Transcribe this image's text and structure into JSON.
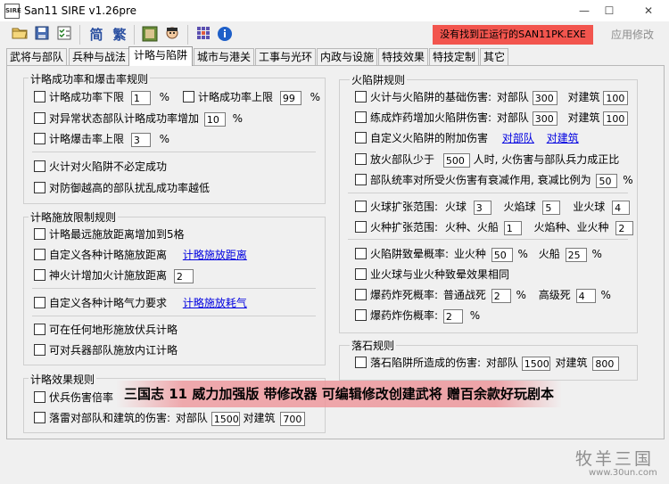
{
  "window": {
    "title": "San11 SIRE v1.26pre",
    "logo_text": "SIRE",
    "minimize": "—",
    "maximize": "☐",
    "close": "✕"
  },
  "toolbar": {
    "simplified": "简",
    "traditional": "繁",
    "status_alert": "没有找到正运行的SAN11PK.EXE",
    "apply_label": "应用修改"
  },
  "tabs": [
    "武将与部队",
    "兵种与战法",
    "计略与陷阱",
    "城市与港关",
    "工事与光环",
    "内政与设施",
    "特技效果",
    "特技定制",
    "其它"
  ],
  "active_tab": "计略与陷阱",
  "strategy_rate": {
    "title": "计略成功率和爆击率规则",
    "min_rate_label": "计略成功率下限",
    "min_rate_value": "1",
    "min_rate_unit": "%",
    "max_rate_label": "计略成功率上限",
    "max_rate_value": "99",
    "max_rate_unit": "%",
    "abnormal_label": "对异常状态部队计略成功率增加",
    "abnormal_value": "10",
    "abnormal_unit": "%",
    "crit_label": "计略爆击率上限",
    "crit_value": "3",
    "crit_unit": "%",
    "fire_label": "火计对火陷阱不必定成功",
    "defense_label": "对防御越高的部队扰乱成功率越低"
  },
  "cast_limit": {
    "title": "计略施放限制规则",
    "max_distance_label": "计略最远施放距离增加到5格",
    "custom_distance_label": "自定义各种计略施放距离",
    "custom_distance_link": "计略施放距离",
    "shenhuo_label": "神火计增加火计施放距离",
    "shenhuo_value": "2",
    "custom_energy_label": "自定义各种计略气力要求",
    "custom_energy_link": "计略施放耗气",
    "ambush_label": "可在任何地形施放伏兵计略",
    "weapon_label": "可对兵器部队施放内讧计略"
  },
  "strategy_effect": {
    "title": "计略效果规则",
    "ambush_dmg_label": "伏兵伤害倍率",
    "thunder_label": "落雷对部队和建筑的伤害:",
    "vs_unit_label": "对部队",
    "vs_unit_value": "1500",
    "vs_building_label": "对建筑",
    "vs_building_value": "700"
  },
  "fire_trap": {
    "title": "火陷阱规则",
    "base_label": "火计与火陷阱的基础伤害:",
    "base_unit_label": "对部队",
    "base_unit_value": "300",
    "base_building_label": "对建筑",
    "base_building_value": "100",
    "explosive_label": "练成炸药增加火陷阱伤害:",
    "explosive_unit_label": "对部队",
    "explosive_unit_value": "300",
    "explosive_building_label": "对建筑",
    "explosive_building_value": "100",
    "custom_label": "自定义火陷阱的附加伤害",
    "custom_unit_link": "对部队",
    "custom_building_link": "对建筑",
    "few_troops_prefix": "放火部队少于",
    "few_troops_value": "500",
    "few_troops_suffix": "人时, 火伤害与部队兵力成正比",
    "decay_label": "部队统率对所受火伤害有衰减作用, 衰减比例为",
    "decay_value": "50",
    "decay_unit": "%",
    "fireball_label": "火球扩张范围:",
    "fireball_name": "火球",
    "fireball_value": "3",
    "flameball_name": "火焰球",
    "flameball_value": "5",
    "hellball_name": "业火球",
    "hellball_value": "4",
    "firetype_label": "火种扩张范围:",
    "firetype_pair1": "火种、火船",
    "firetype_value1": "1",
    "firetype_pair2": "火焰种、业火种",
    "firetype_value2": "2",
    "ignite_label": "火陷阱致晕概率:",
    "ignite_name1": "业火种",
    "ignite_value1": "50",
    "ignite_unit1": "%",
    "ignite_name2": "火船",
    "ignite_value2": "25",
    "ignite_unit2": "%",
    "same_effect_label": "业火球与业火种致晕效果相同",
    "explode_death_label": "爆药炸死概率:",
    "normal_death_label": "普通战死",
    "normal_death_value": "2",
    "normal_death_unit": "%",
    "high_death_label": "高级死",
    "high_death_value": "4",
    "high_death_unit": "%",
    "explode_injury_label": "爆药炸伤概率:",
    "explode_injury_value": "2",
    "explode_injury_unit": "%"
  },
  "rockfall": {
    "title": "落石规则",
    "label": "落石陷阱所造成的伤害:",
    "unit_label": "对部队",
    "unit_value": "1500",
    "building_label": "对建筑",
    "building_value": "800"
  },
  "overlay": {
    "banner": "三国志 11 威力加强版 带修改器 可编辑修改创建武将 赠百余款好玩剧本",
    "watermark_name": "牧羊三国",
    "watermark_url": "www.30un.com"
  }
}
